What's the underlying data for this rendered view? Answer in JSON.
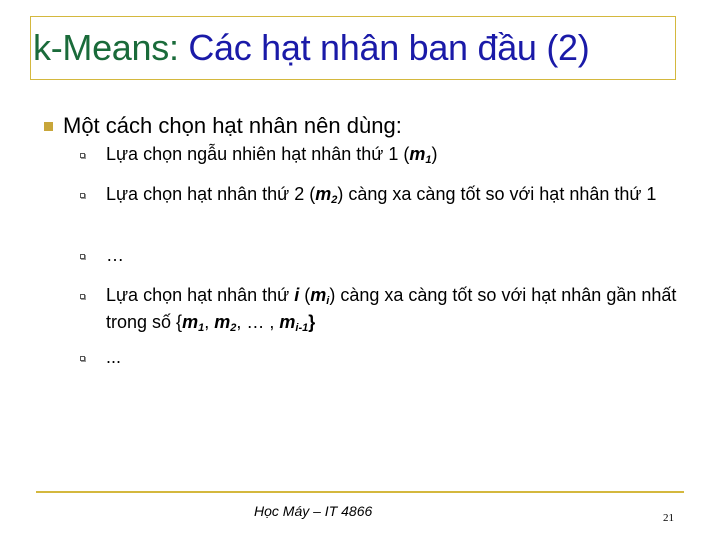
{
  "title": {
    "part1": "k-Means: ",
    "part2": "Các hạt nhân ban đầu (2)"
  },
  "bullet_main": "Một cách chọn hạt nhân nên dùng:",
  "items": {
    "i1": {
      "text": "Lựa chọn ngẫu nhiên hạt nhân thứ 1  (",
      "m": "m",
      "sub": "1",
      "close": ")"
    },
    "i2": {
      "text": "Lựa chọn hạt nhân thứ 2  (",
      "m": "m",
      "sub": "2",
      "rest": ")  càng xa càng tốt so với hạt nhân thứ 1"
    },
    "i3": {
      "text": "…"
    },
    "i4": {
      "text": "Lựa chọn hạt nhân thứ ",
      "i": "i",
      "open": "  (",
      "m": "m",
      "sub": "i",
      "rest": ")  càng xa càng tốt so với hạt nhân gần nhất trong số {",
      "m1": "m",
      "s1": "1",
      "c1": ", ",
      "m2": "m",
      "s2": "2",
      "c2": ", … , ",
      "m3": "m",
      "s3": "i-1",
      "end": "}"
    },
    "i5": {
      "text": "..."
    }
  },
  "footer": "Học Máy – IT 4866",
  "page_number": "21",
  "colors": {
    "title_green": "#1a6b3a",
    "title_blue": "#1a1aa8",
    "accent_gold": "#d4b83e"
  }
}
